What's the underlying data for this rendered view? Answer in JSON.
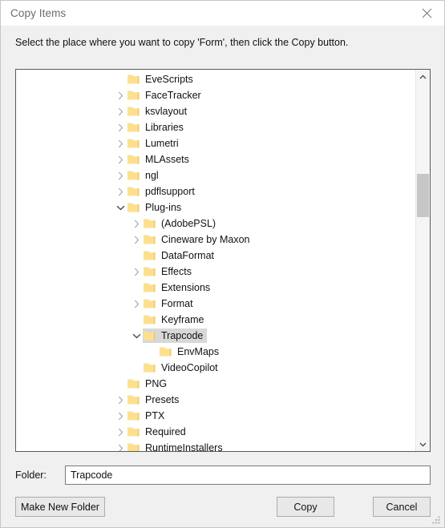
{
  "window": {
    "title": "Copy Items",
    "close_icon": "close-icon"
  },
  "instruction": "Select the place where you want to copy 'Form', then click the Copy button.",
  "tree": {
    "scroll_up_icon": "chevron-up-icon",
    "scroll_down_icon": "chevron-down-icon",
    "items": [
      {
        "label": "EveScripts",
        "level": 1,
        "expander": "none",
        "selected": false
      },
      {
        "label": "FaceTracker",
        "level": 1,
        "expander": "collapsed",
        "selected": false
      },
      {
        "label": "ksvlayout",
        "level": 1,
        "expander": "collapsed",
        "selected": false
      },
      {
        "label": "Libraries",
        "level": 1,
        "expander": "collapsed",
        "selected": false
      },
      {
        "label": "Lumetri",
        "level": 1,
        "expander": "collapsed",
        "selected": false
      },
      {
        "label": "MLAssets",
        "level": 1,
        "expander": "collapsed",
        "selected": false
      },
      {
        "label": "ngl",
        "level": 1,
        "expander": "collapsed",
        "selected": false
      },
      {
        "label": "pdflsupport",
        "level": 1,
        "expander": "collapsed",
        "selected": false
      },
      {
        "label": "Plug-ins",
        "level": 1,
        "expander": "expanded",
        "selected": false
      },
      {
        "label": "(AdobePSL)",
        "level": 2,
        "expander": "collapsed",
        "selected": false
      },
      {
        "label": "Cineware by Maxon",
        "level": 2,
        "expander": "collapsed",
        "selected": false
      },
      {
        "label": "DataFormat",
        "level": 2,
        "expander": "none",
        "selected": false
      },
      {
        "label": "Effects",
        "level": 2,
        "expander": "collapsed",
        "selected": false
      },
      {
        "label": "Extensions",
        "level": 2,
        "expander": "none",
        "selected": false
      },
      {
        "label": "Format",
        "level": 2,
        "expander": "collapsed",
        "selected": false
      },
      {
        "label": "Keyframe",
        "level": 2,
        "expander": "none",
        "selected": false
      },
      {
        "label": "Trapcode",
        "level": 2,
        "expander": "expanded",
        "selected": true
      },
      {
        "label": "EnvMaps",
        "level": 3,
        "expander": "none",
        "selected": false
      },
      {
        "label": "VideoCopilot",
        "level": 2,
        "expander": "none",
        "selected": false
      },
      {
        "label": "PNG",
        "level": 1,
        "expander": "none",
        "selected": false
      },
      {
        "label": "Presets",
        "level": 1,
        "expander": "collapsed",
        "selected": false
      },
      {
        "label": "PTX",
        "level": 1,
        "expander": "collapsed",
        "selected": false
      },
      {
        "label": "Required",
        "level": 1,
        "expander": "collapsed",
        "selected": false
      },
      {
        "label": "RuntimeInstallers",
        "level": 1,
        "expander": "collapsed",
        "selected": false
      }
    ]
  },
  "folder": {
    "label": "Folder:",
    "value": "Trapcode",
    "placeholder": ""
  },
  "buttons": {
    "new_folder": "Make New Folder",
    "copy": "Copy",
    "cancel": "Cancel"
  },
  "colors": {
    "dialog_bg": "#f0f0f0",
    "titlebar_bg": "#ffffff",
    "panel_bg": "#ffffff",
    "panel_border": "#5a5a5a",
    "folder_icon": "#fbe18f",
    "selection": "#d8d8d8",
    "scrollbar_thumb": "#c6c6c6",
    "text": "#111111"
  }
}
